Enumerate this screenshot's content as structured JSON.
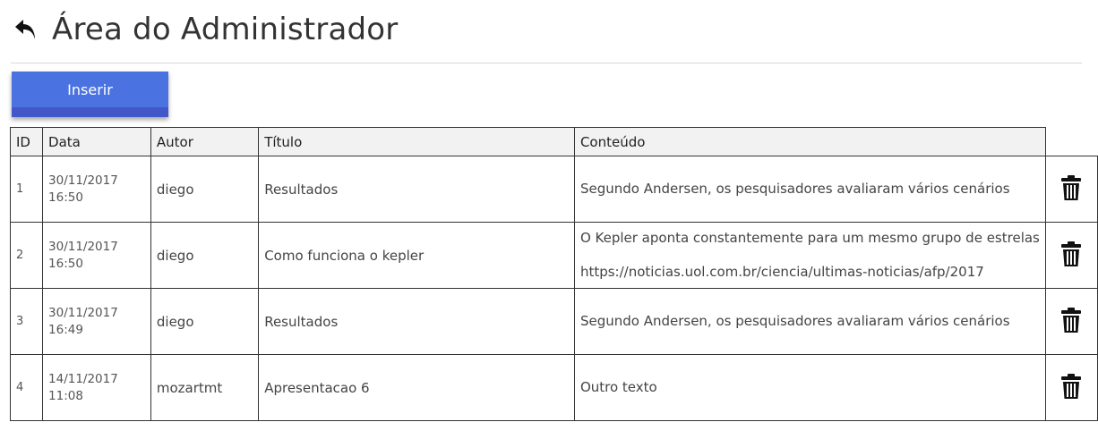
{
  "header": {
    "title": "Área do Administrador",
    "back_icon": "undo-arrow-icon"
  },
  "toolbar": {
    "insert_label": "Inserir"
  },
  "colors": {
    "button_top": "#4a72e0",
    "button_bottom": "#4457c9",
    "header_bg": "#f2f2f2",
    "border": "#333333"
  },
  "table": {
    "columns": [
      "ID",
      "Data",
      "Autor",
      "Título",
      "Conteúdo"
    ],
    "rows": [
      {
        "id": "1",
        "date": "30/11/2017",
        "time": "16:50",
        "author": "diego",
        "title": "Resultados",
        "content": [
          "Segundo Andersen, os pesquisadores avaliaram vários cenários"
        ]
      },
      {
        "id": "2",
        "date": "30/11/2017",
        "time": "16:50",
        "author": "diego",
        "title": "Como funciona o kepler",
        "content": [
          "O Kepler aponta constantemente para um mesmo grupo de estrelas",
          "https://noticias.uol.com.br/ciencia/ultimas-noticias/afp/2017"
        ]
      },
      {
        "id": "3",
        "date": "30/11/2017",
        "time": "16:49",
        "author": "diego",
        "title": "Resultados",
        "content": [
          "Segundo Andersen, os pesquisadores avaliaram vários cenários"
        ]
      },
      {
        "id": "4",
        "date": "14/11/2017",
        "time": "11:08",
        "author": "mozartmt",
        "title": "Apresentacao 6",
        "content": [
          "Outro texto"
        ]
      }
    ],
    "row_action_icon": "trash-icon"
  }
}
